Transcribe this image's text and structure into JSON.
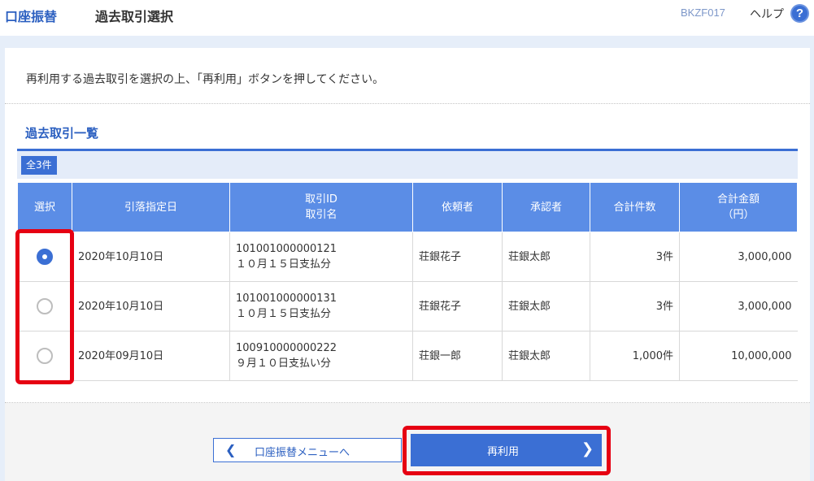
{
  "header": {
    "app_title": "口座振替",
    "screen_title": "過去取引選択",
    "screen_id": "BKZF017",
    "help_label": "ヘルプ",
    "help_icon": "?"
  },
  "instruction": "再利用する過去取引を選択の上、「再利用」ボタンを押してください。",
  "section": {
    "title": "過去取引一覧",
    "count_badge": "全3件"
  },
  "table": {
    "columns": [
      "選択",
      "引落指定日",
      "取引ID\n取引名",
      "依頼者",
      "承認者",
      "合計件数",
      "合計金額\n（円）"
    ],
    "columns_line": {
      "col3_line1": "取引ID",
      "col3_line2": "取引名",
      "col7_line1": "合計金額",
      "col7_line2": "（円）"
    },
    "rows": [
      {
        "selected": true,
        "date": "2020年10月10日",
        "id": "101001000000121",
        "name": "１０月１５日支払分",
        "requester": "荘銀花子",
        "approver": "荘銀太郎",
        "count": "3件",
        "amount": "3,000,000"
      },
      {
        "selected": false,
        "date": "2020年10月10日",
        "id": "101001000000131",
        "name": "１０月１５日支払分",
        "requester": "荘銀花子",
        "approver": "荘銀太郎",
        "count": "3件",
        "amount": "3,000,000"
      },
      {
        "selected": false,
        "date": "2020年09月10日",
        "id": "100910000000222",
        "name": "９月１０日支払い分",
        "requester": "荘銀一郎",
        "approver": "荘銀太郎",
        "count": "1,000件",
        "amount": "10,000,000"
      }
    ]
  },
  "buttons": {
    "menu_label": "口座振替メニューへ",
    "menu_chevron": "❮",
    "reuse_label": "再利用",
    "reuse_chevron": "❯"
  },
  "colors": {
    "accent": "#3b6fd4",
    "header_cell": "#5b8de6",
    "highlight": "#e60012"
  }
}
